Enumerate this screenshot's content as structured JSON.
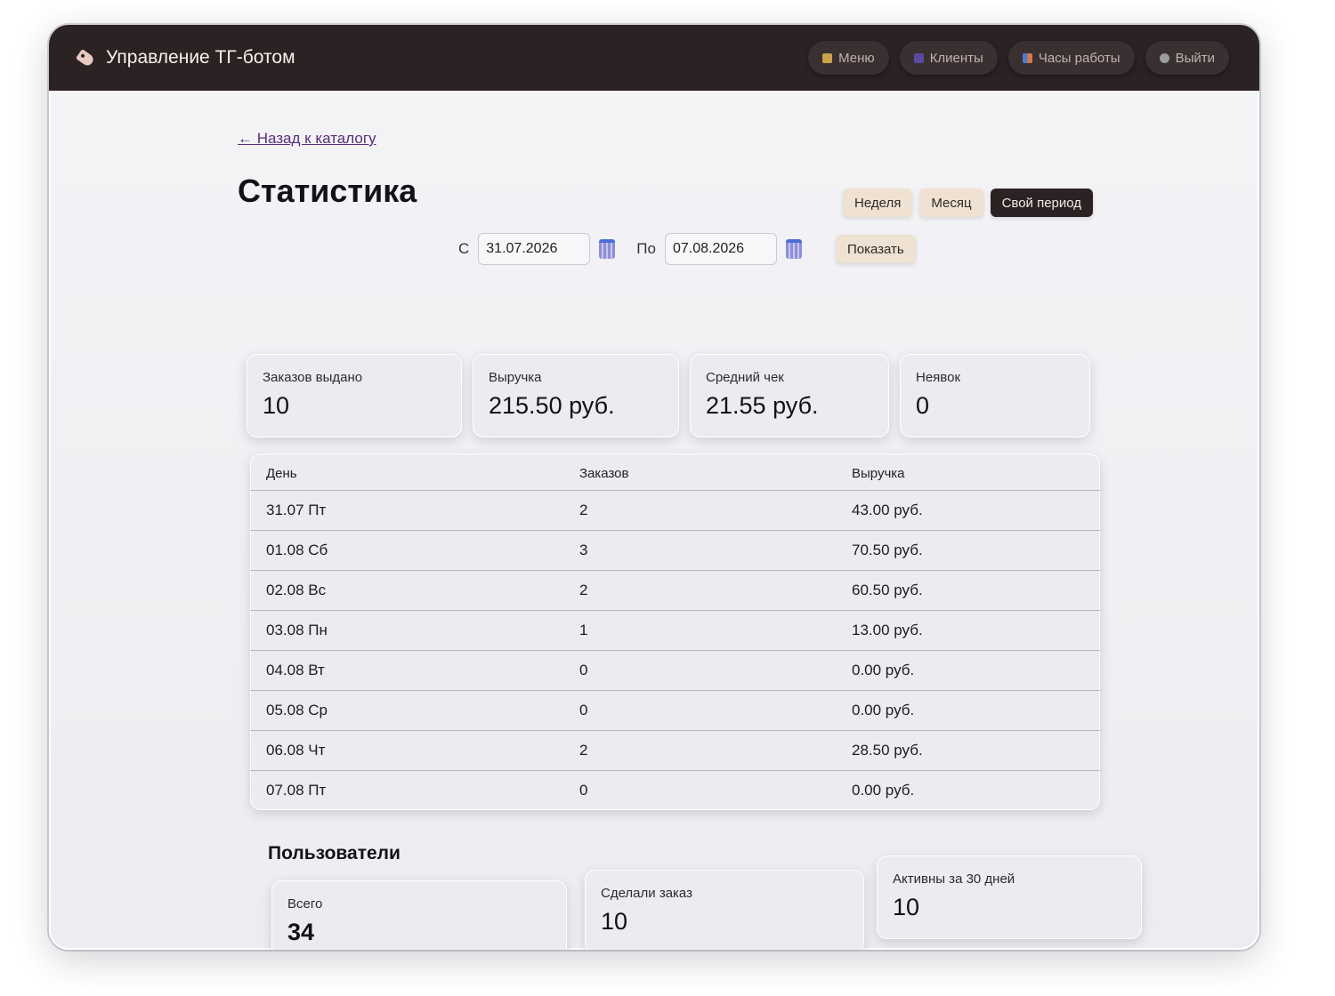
{
  "app": {
    "title": "Управление ТГ-ботом",
    "nav": [
      {
        "label": "Меню",
        "icon": "menu-icon"
      },
      {
        "label": "Клиенты",
        "icon": "clients-icon"
      },
      {
        "label": "Часы работы",
        "icon": "calendar-icon"
      },
      {
        "label": "Выйти",
        "icon": "exit-icon"
      }
    ]
  },
  "page": {
    "back_link": "← Назад к каталогу",
    "title": "Статистика",
    "period_tabs": [
      {
        "label": "Неделя",
        "active": false
      },
      {
        "label": "Месяц",
        "active": false
      },
      {
        "label": "Свой период",
        "active": true
      }
    ],
    "date_range": {
      "from_label": "С",
      "from_value": "31.07.2026",
      "to_label": "По",
      "to_value": "07.08.2026",
      "show_button": "Показать"
    }
  },
  "summary": {
    "orders": {
      "label": "Заказов выдано",
      "value": "10"
    },
    "revenue": {
      "label": "Выручка",
      "value": "215.50 руб."
    },
    "avg_check": {
      "label": "Средний чек",
      "value": "21.55 руб."
    },
    "no_shows": {
      "label": "Неявок",
      "value": "0"
    }
  },
  "table": {
    "headers": [
      "День",
      "Заказов",
      "Выручка"
    ],
    "rows": [
      [
        "31.07 Пт",
        "2",
        "43.00 руб."
      ],
      [
        "01.08 Сб",
        "3",
        "70.50 руб."
      ],
      [
        "02.08 Вс",
        "2",
        "60.50 руб."
      ],
      [
        "03.08 Пн",
        "1",
        "13.00 руб."
      ],
      [
        "04.08 Вт",
        "0",
        "0.00 руб."
      ],
      [
        "05.08 Ср",
        "0",
        "0.00 руб."
      ],
      [
        "06.08 Чт",
        "2",
        "28.50 руб."
      ],
      [
        "07.08 Пт",
        "0",
        "0.00 руб."
      ]
    ]
  },
  "users": {
    "title": "Пользователи",
    "total": {
      "label": "Всего",
      "value": "34"
    },
    "ordered": {
      "label": "Сделали заказ",
      "value": "10"
    },
    "active30": {
      "label": "Активны за 30 дней",
      "value": "10"
    }
  },
  "colors": {
    "topbar": "#2b2224",
    "accent_button": "#efe2d2",
    "active_tab": "#2b2224",
    "link": "#5a2c7a"
  }
}
